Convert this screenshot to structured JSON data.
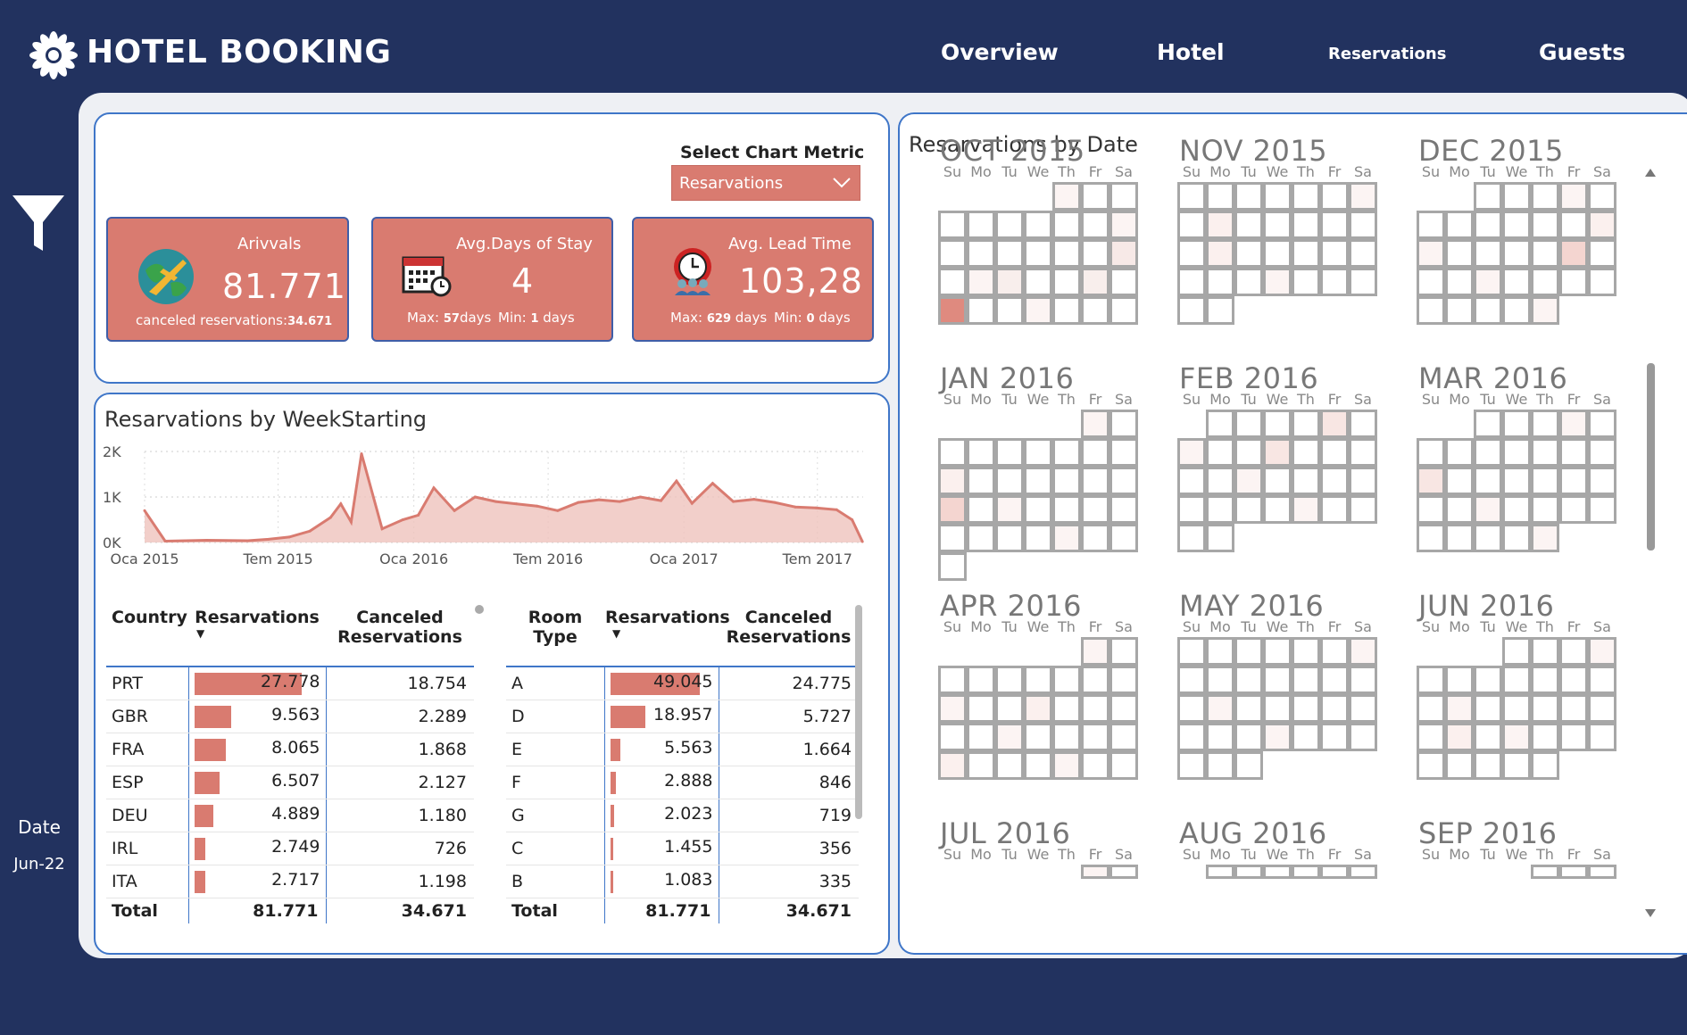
{
  "header": {
    "title": "HOTEL BOOKING",
    "nav": [
      "Overview",
      "Hotel",
      "Reservations",
      "Guests"
    ]
  },
  "sidebar": {
    "date_label": "Date",
    "date_value": "Jun-22"
  },
  "colors": {
    "navy": "#22325f",
    "accent": "#d97b70",
    "panel_border": "#3f76c8"
  },
  "metric_selector": {
    "label": "Select Chart Metric",
    "value": "Resarvations"
  },
  "cards": {
    "arrivals": {
      "title": "Arivvals",
      "value": "81.771",
      "sub_label": "canceled reservations:",
      "sub_value": "34.671"
    },
    "avg_stay": {
      "title": "Avg.Days of Stay",
      "value": "4",
      "max_label": "Max:",
      "max_value": "57",
      "max_unit": "days",
      "min_label": "Min:",
      "min_value": "1",
      "min_unit": "days"
    },
    "lead_time": {
      "title": "Avg. Lead Time",
      "value": "103,28",
      "max_label": "Max:",
      "max_value": "629",
      "max_unit": "days",
      "min_label": "Min:",
      "min_value": "0",
      "min_unit": "days"
    }
  },
  "weekly_chart": {
    "title": "Resarvations by WeekStarting"
  },
  "chart_data": {
    "type": "area",
    "title": "Resarvations by WeekStarting",
    "x": [
      "2015-01-01",
      "2015-01-29",
      "2015-03-26",
      "2015-05-21",
      "2015-06-18",
      "2015-07-16",
      "2015-08-13",
      "2015-09-10",
      "2015-09-24",
      "2015-10-08",
      "2015-10-22",
      "2015-11-19",
      "2015-12-17",
      "2016-01-07",
      "2016-01-28",
      "2016-02-25",
      "2016-03-24",
      "2016-04-21",
      "2016-05-19",
      "2016-06-16",
      "2016-07-14",
      "2016-08-11",
      "2016-09-08",
      "2016-10-06",
      "2016-11-03",
      "2016-12-01",
      "2016-12-22",
      "2017-01-12",
      "2017-02-09",
      "2017-03-09",
      "2017-04-06",
      "2017-05-04",
      "2017-06-01",
      "2017-06-29",
      "2017-07-27",
      "2017-08-17",
      "2017-08-31"
    ],
    "values": [
      700,
      30,
      50,
      40,
      70,
      120,
      250,
      550,
      850,
      450,
      1950,
      300,
      500,
      600,
      1200,
      700,
      1000,
      900,
      850,
      800,
      700,
      880,
      940,
      900,
      1000,
      920,
      1350,
      860,
      1300,
      900,
      950,
      880,
      780,
      760,
      720,
      500,
      20
    ],
    "x_tick_labels": [
      "Oca 2015",
      "Tem 2015",
      "Oca 2016",
      "Tem 2016",
      "Oca 2017",
      "Tem 2017"
    ],
    "y_tick_labels": [
      "0K",
      "1K",
      "2K"
    ],
    "ylim": [
      0,
      2000
    ],
    "grid": true
  },
  "country_table": {
    "headers": [
      "Country",
      "Resarvations",
      "Canceled Reservations"
    ],
    "rows": [
      {
        "key": "PRT",
        "res": "27.778",
        "res_num": 27778,
        "can": "18.754"
      },
      {
        "key": "GBR",
        "res": "9.563",
        "res_num": 9563,
        "can": "2.289"
      },
      {
        "key": "FRA",
        "res": "8.065",
        "res_num": 8065,
        "can": "1.868"
      },
      {
        "key": "ESP",
        "res": "6.507",
        "res_num": 6507,
        "can": "2.127"
      },
      {
        "key": "DEU",
        "res": "4.889",
        "res_num": 4889,
        "can": "1.180"
      },
      {
        "key": "IRL",
        "res": "2.749",
        "res_num": 2749,
        "can": "726"
      },
      {
        "key": "ITA",
        "res": "2.717",
        "res_num": 2717,
        "can": "1.198"
      }
    ],
    "total": {
      "key": "Total",
      "res": "81.771",
      "can": "34.671"
    }
  },
  "room_table": {
    "headers": [
      "Room Type",
      "Resarvations",
      "Canceled Reservations"
    ],
    "rows": [
      {
        "key": "A",
        "res": "49.045",
        "res_num": 49045,
        "can": "24.775"
      },
      {
        "key": "D",
        "res": "18.957",
        "res_num": 18957,
        "can": "5.727"
      },
      {
        "key": "E",
        "res": "5.563",
        "res_num": 5563,
        "can": "1.664"
      },
      {
        "key": "F",
        "res": "2.888",
        "res_num": 2888,
        "can": "846"
      },
      {
        "key": "G",
        "res": "2.023",
        "res_num": 2023,
        "can": "719"
      },
      {
        "key": "C",
        "res": "1.455",
        "res_num": 1455,
        "can": "356"
      },
      {
        "key": "B",
        "res": "1.083",
        "res_num": 1083,
        "can": "335"
      }
    ],
    "total": {
      "key": "Total",
      "res": "81.771",
      "can": "34.671"
    }
  },
  "calendar": {
    "title": "Resarvations by Date",
    "weekday_labels": [
      "Su",
      "Mo",
      "Tu",
      "We",
      "Th",
      "Fr",
      "Sa"
    ],
    "months": [
      {
        "label": "OCT 2015",
        "start": 4,
        "days": 31
      },
      {
        "label": "NOV 2015",
        "start": 0,
        "days": 30
      },
      {
        "label": "DEC 2015",
        "start": 2,
        "days": 31
      },
      {
        "label": "JAN 2016",
        "start": 5,
        "days": 31
      },
      {
        "label": "FEB 2016",
        "start": 1,
        "days": 29
      },
      {
        "label": "MAR 2016",
        "start": 2,
        "days": 31
      },
      {
        "label": "APR 2016",
        "start": 5,
        "days": 30
      },
      {
        "label": "MAY 2016",
        "start": 0,
        "days": 31
      },
      {
        "label": "JUN 2016",
        "start": 3,
        "days": 30
      },
      {
        "label": "JUL 2016",
        "start": 5,
        "days": 31
      },
      {
        "label": "AUG 2016",
        "start": 1,
        "days": 31
      },
      {
        "label": "SEP 2016",
        "start": 4,
        "days": 30
      }
    ]
  }
}
